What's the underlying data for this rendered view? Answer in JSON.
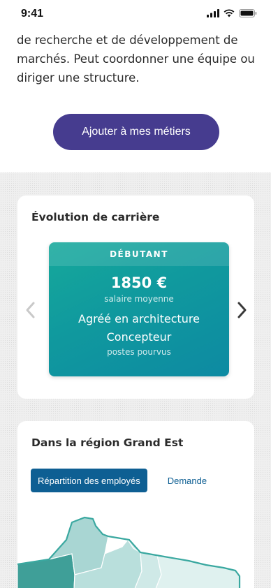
{
  "status_bar": {
    "time": "9:41"
  },
  "intro": {
    "lines": [
      "de recherche et de développement de",
      "marchés. Peut coordonner une équipe ou",
      "diriger une structure."
    ]
  },
  "cta": {
    "label": "Ajouter à mes métiers"
  },
  "career": {
    "title": "Évolution de carrière",
    "level": "DÉBUTANT",
    "salary": "1850 €",
    "salary_label": "salaire moyenne",
    "jobs": [
      "Agréé en architecture",
      "Concepteur"
    ],
    "jobs_label": "postes pourvus"
  },
  "region": {
    "title": "Dans la région Grand Est",
    "tabs": [
      {
        "label": "Répartition des employés",
        "active": true
      },
      {
        "label": "Demande",
        "active": false
      }
    ]
  },
  "colors": {
    "cta": "#463c8f",
    "tab_active": "#0e5f93",
    "card_gradient_start": "#16a99b",
    "card_gradient_end": "#0d8aa2"
  }
}
